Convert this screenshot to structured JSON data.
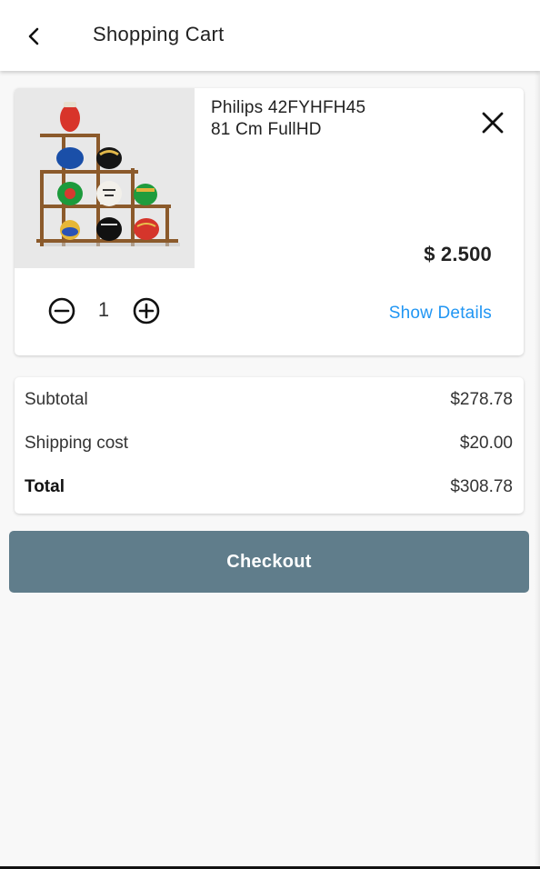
{
  "header": {
    "title": "Shopping Cart",
    "back_icon": "chevron-left-icon"
  },
  "cart": {
    "items": [
      {
        "name_line1": "Philips 42FYHFH45",
        "name_line2": "81 Cm FullHD",
        "price": "$ 2.500",
        "quantity": "1",
        "details_label": "Show Details",
        "image": "wall-shelf-with-painted-pots-image",
        "remove_icon": "close-icon",
        "minus_icon": "minus-circle-icon",
        "plus_icon": "plus-circle-icon"
      }
    ]
  },
  "summary": {
    "subtotal_label": "Subtotal",
    "subtotal_value": "$278.78",
    "shipping_label": "Shipping cost",
    "shipping_value": "$20.00",
    "total_label": "Total",
    "total_value": "$308.78"
  },
  "checkout": {
    "label": "Checkout"
  },
  "colors": {
    "accent_link": "#2196f3",
    "checkout_bg": "#607d8b",
    "page_bg": "#f8f8f8"
  }
}
